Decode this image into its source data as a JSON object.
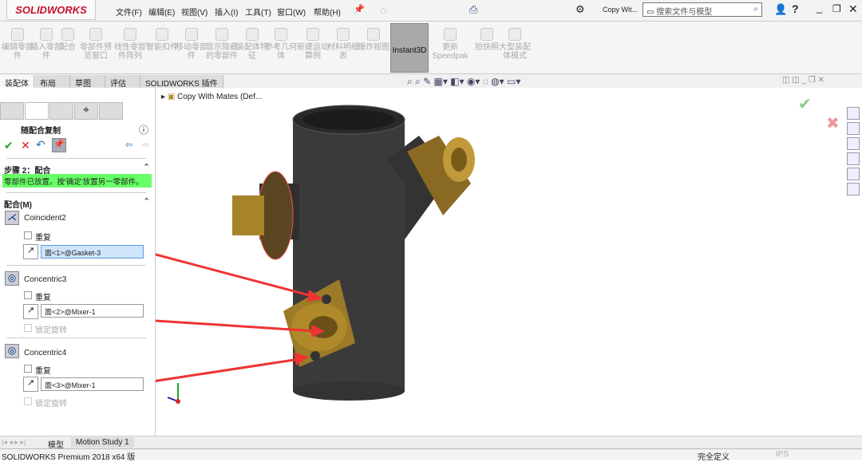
{
  "app": {
    "logo": "SOLIDWORKS",
    "doc_short": "Copy Wit...",
    "search_placeholder": "搜索文件与模型"
  },
  "menu": [
    "文件(F)",
    "编辑(E)",
    "视图(V)",
    "插入(I)",
    "工具(T)",
    "窗口(W)",
    "帮助(H)"
  ],
  "ribbon": [
    "编辑零部件",
    "插入零部件",
    "配合",
    "零部件预览窗口",
    "线性零部件阵列",
    "智能扣件",
    "移动零部件",
    "显示隐藏的零部件",
    "装配体特征",
    "参考几何体",
    "新建运动算例",
    "材料明细表",
    "爆炸视图",
    "Instant3D",
    "更新Speedpak",
    "拍快照",
    "大型装配体模式"
  ],
  "tabs": [
    "装配体",
    "布局",
    "草图",
    "评估",
    "SOLIDWORKS 插件"
  ],
  "tree": {
    "root": "Copy With Mates  (Def..."
  },
  "panel": {
    "title": "随配合复制",
    "step": "步骤 2：配合",
    "message": "零部件已放置。按'确定'放置另一零部件。",
    "message_color": "#66ff66",
    "mates_header": "配合(M)",
    "mates": [
      {
        "name": "Coincident2",
        "repeat": "重复",
        "selection": "面<1>@Gasket-3"
      },
      {
        "name": "Concentric3",
        "repeat": "重复",
        "selection": "面<2>@Mixer-1",
        "lock": "锁定旋转"
      },
      {
        "name": "Concentric4",
        "repeat": "重复",
        "selection": "面<3>@Mixer-1",
        "lock": "锁定旋转"
      }
    ]
  },
  "bottom_tabs": [
    "模型",
    "Motion Study 1"
  ],
  "status": {
    "version": "SOLIDWORKS Premium 2018 x64 版",
    "state": "完全定义",
    "units": "IPS"
  },
  "colors": {
    "accent": "#c8102e",
    "arrow": "#ee3333",
    "brass": "#b08a2a",
    "body": "#3a3a3a"
  }
}
